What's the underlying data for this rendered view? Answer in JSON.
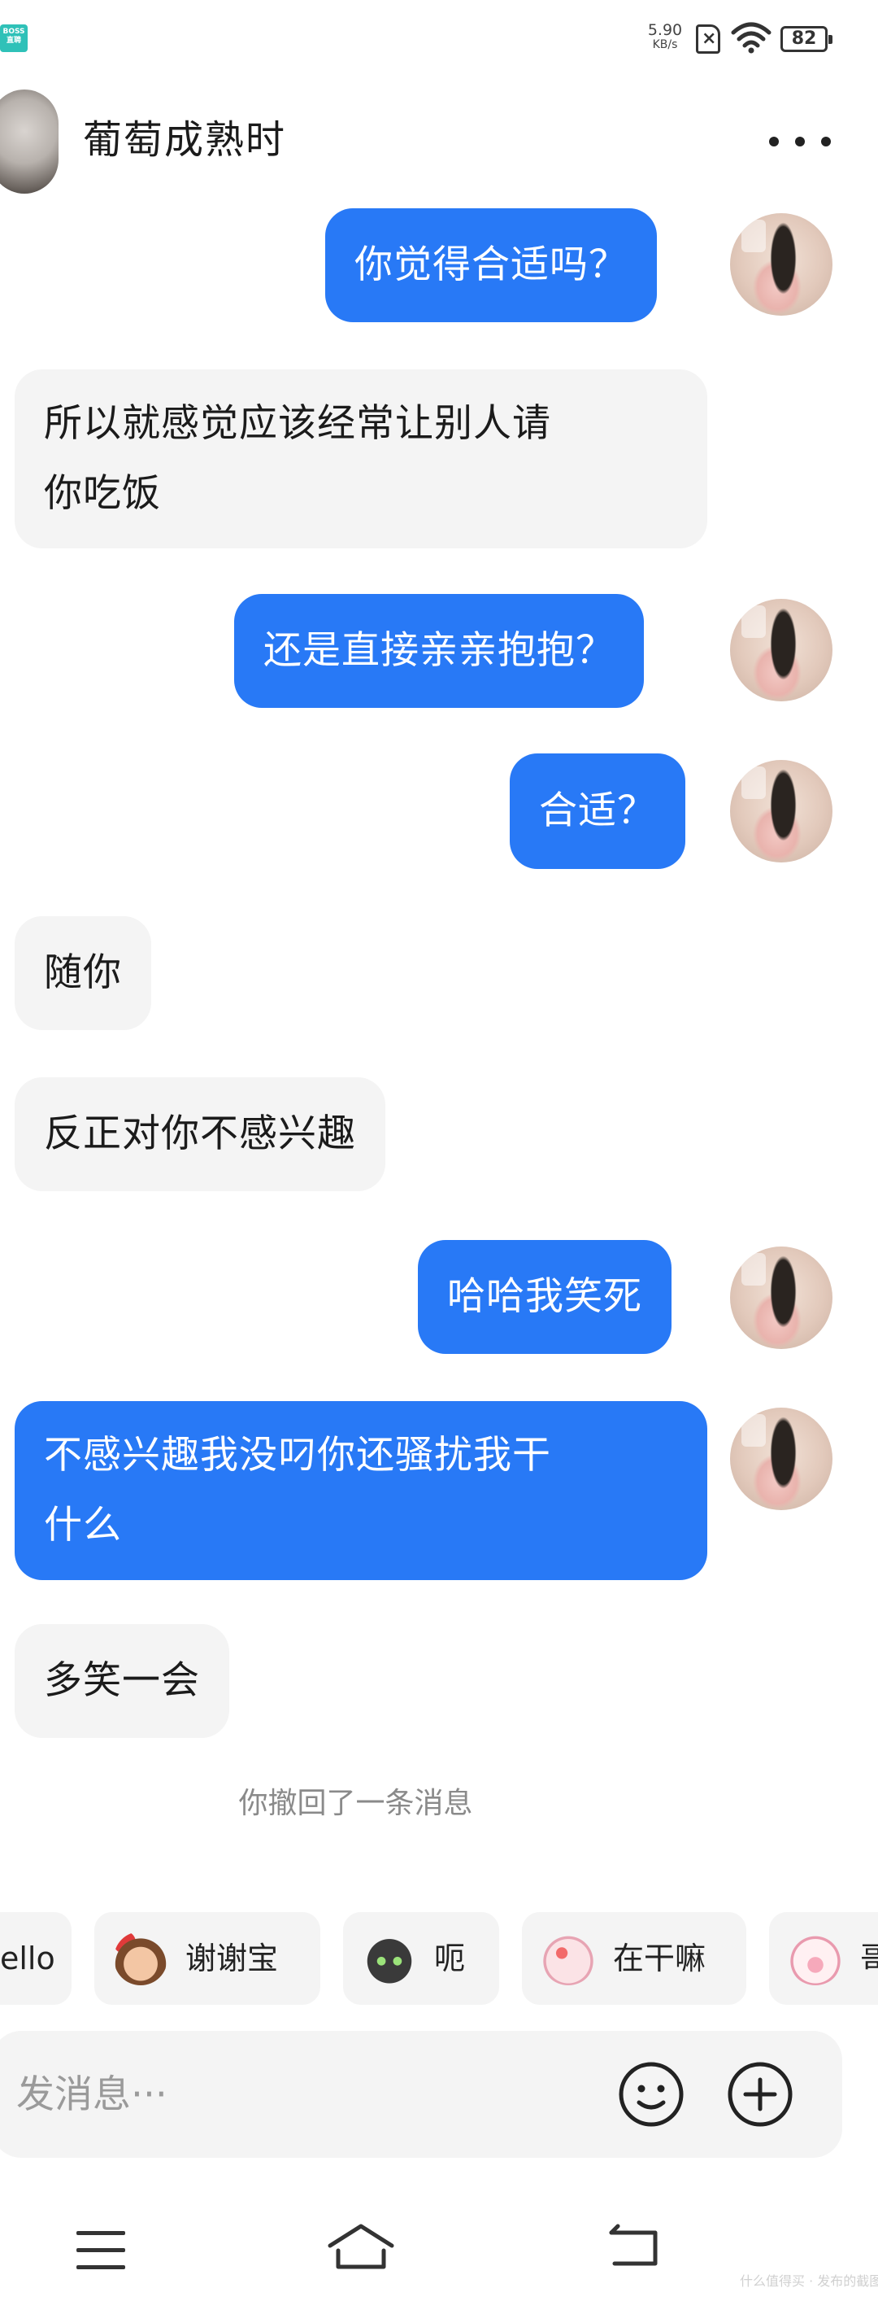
{
  "status_bar": {
    "app_badge": "BOSS直聘",
    "net_speed_value": "5.90",
    "net_speed_unit": "KB/s",
    "sim_mark": "×",
    "battery": "82"
  },
  "header": {
    "title": "葡萄成熟时"
  },
  "messages": [
    {
      "side": "sent",
      "text": "你觉得合适吗？"
    },
    {
      "side": "recv",
      "text": "所以就感觉应该经常让别人请\n你吃饭"
    },
    {
      "side": "sent",
      "text": "还是直接亲亲抱抱？"
    },
    {
      "side": "sent",
      "text": "合适？"
    },
    {
      "side": "recv",
      "text": "随你"
    },
    {
      "side": "recv",
      "text": "反正对你不感兴趣"
    },
    {
      "side": "sent",
      "text": "哈哈我笑死"
    },
    {
      "side": "sent",
      "text": "不感兴趣我没叼你还骚扰我干\n什么"
    },
    {
      "side": "recv",
      "text": "多笑一会"
    }
  ],
  "system_note": "你撤回了一条消息",
  "quick_replies": [
    {
      "label": "ello",
      "sticker": "none"
    },
    {
      "label": "谢谢宝",
      "sticker": "girl-with-rose-sticker"
    },
    {
      "label": "呃",
      "sticker": "cat-sticker"
    },
    {
      "label": "在干嘛",
      "sticker": "pig-magnifier-sticker"
    },
    {
      "label": "哥",
      "sticker": "pig-sticker"
    }
  ],
  "input": {
    "placeholder": "发消息···"
  },
  "icons": {
    "more": "more-dots-icon",
    "emoji": "emoji-face-icon",
    "plus": "plus-circle-icon",
    "nav_menu": "menu-icon",
    "nav_home": "home-icon",
    "nav_back": "back-icon"
  },
  "colors": {
    "sent_bubble": "#2879f6",
    "recv_bubble": "#f4f4f4"
  },
  "watermark": "什么值得买 · 发布的截图"
}
